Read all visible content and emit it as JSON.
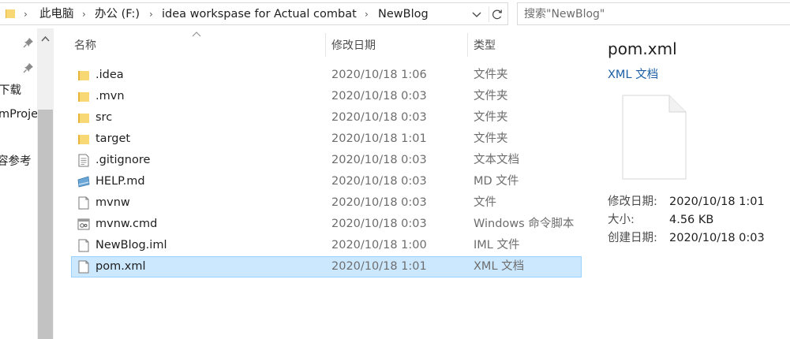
{
  "address_bar": {
    "crumbs": [
      "此电脑",
      "办公 (F:)",
      "idea workspase for Actual combat",
      "NewBlog"
    ],
    "separator": "›"
  },
  "search": {
    "placeholder": "搜索\"NewBlog\""
  },
  "nav": {
    "items": [
      "下载",
      "mProje",
      "容参考"
    ]
  },
  "columns": {
    "name": "名称",
    "date": "修改日期",
    "type": "类型"
  },
  "files": [
    {
      "name": ".idea",
      "date": "2020/10/18 1:06",
      "type": "文件夹",
      "icon": "folder-icon"
    },
    {
      "name": ".mvn",
      "date": "2020/10/18 0:03",
      "type": "文件夹",
      "icon": "folder-icon"
    },
    {
      "name": "src",
      "date": "2020/10/18 0:03",
      "type": "文件夹",
      "icon": "folder-icon"
    },
    {
      "name": "target",
      "date": "2020/10/18 1:01",
      "type": "文件夹",
      "icon": "folder-icon"
    },
    {
      "name": ".gitignore",
      "date": "2020/10/18 0:03",
      "type": "文本文档",
      "icon": "text-document-icon"
    },
    {
      "name": "HELP.md",
      "date": "2020/10/18 0:03",
      "type": "MD 文件",
      "icon": "markdown-file-icon"
    },
    {
      "name": "mvnw",
      "date": "2020/10/18 0:03",
      "type": "文件",
      "icon": "blank-file-icon"
    },
    {
      "name": "mvnw.cmd",
      "date": "2020/10/18 0:03",
      "type": "Windows 命令脚本",
      "icon": "cmd-script-icon"
    },
    {
      "name": "NewBlog.iml",
      "date": "2020/10/18 1:00",
      "type": "IML 文件",
      "icon": "blank-file-icon"
    },
    {
      "name": "pom.xml",
      "date": "2020/10/18 1:01",
      "type": "XML 文档",
      "icon": "blank-file-icon",
      "selected": true
    }
  ],
  "details": {
    "name": "pom.xml",
    "type": "XML 文档",
    "props": [
      {
        "key": "修改日期:",
        "value": "2020/10/18 1:01"
      },
      {
        "key": "大小:",
        "value": "4.56 KB"
      },
      {
        "key": "创建日期:",
        "value": "2020/10/18 0:03"
      }
    ]
  },
  "colors": {
    "selection_bg": "#cce8ff",
    "selection_border": "#99d1ff",
    "folder": "#f8d775",
    "link": "#1a5fa6"
  }
}
